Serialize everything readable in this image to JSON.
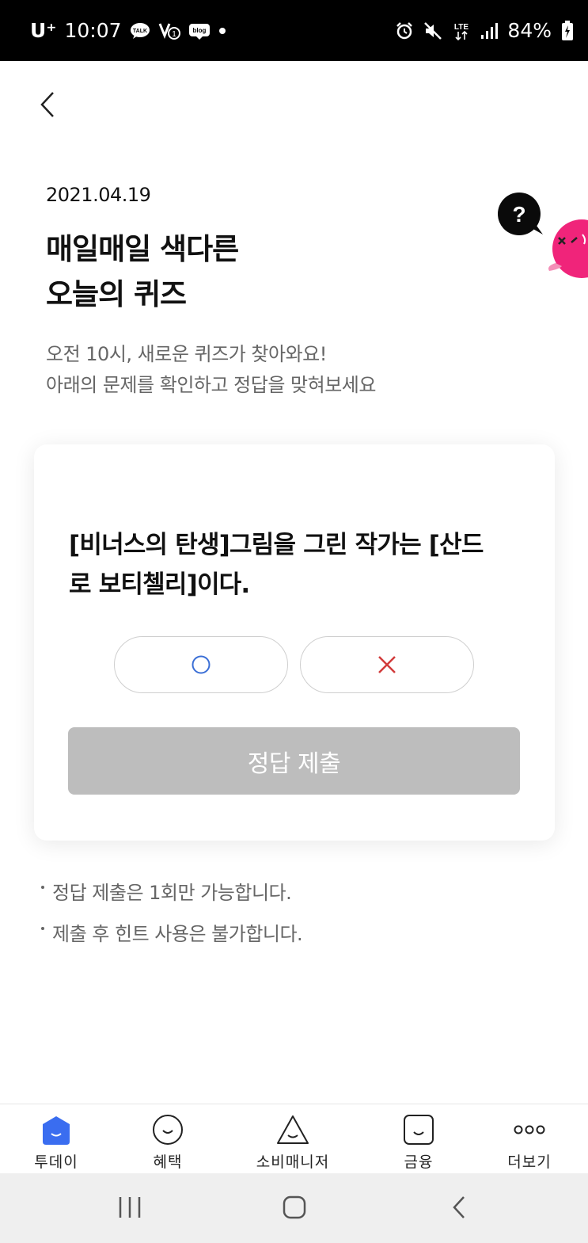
{
  "status_bar": {
    "carrier": "U⁺",
    "time": "10:07",
    "battery": "84%",
    "network": "LTE",
    "notification_icons": [
      "talk-icon",
      "vpn-icon",
      "blog-icon",
      "dot-icon"
    ],
    "system_icons": [
      "alarm-icon",
      "mute-icon",
      "lte-icon",
      "signal-icon",
      "battery-icon"
    ]
  },
  "header": {
    "back_icon": "chevron-left-icon"
  },
  "quiz": {
    "date": "2021.04.19",
    "title_line1": "매일매일 색다른",
    "title_line2": "오늘의 퀴즈",
    "subtitle_line1": "오전 10시, 새로운 퀴즈가 찾아와요!",
    "subtitle_line2": "아래의 문제를 확인하고 정답을 맞혀보세요",
    "mascot_badge": "?",
    "question_line1": "[비너스의 탄생]그림을 그린 작가는 [산드",
    "question_line2": "로 보티첼리]이다.",
    "choices": [
      {
        "name": "O",
        "icon": "circle-icon",
        "color": "#3b6fd6"
      },
      {
        "name": "X",
        "icon": "cross-icon",
        "color": "#d23b3b"
      }
    ],
    "submit_label": "정답 제출"
  },
  "notes": [
    "정답 제출은 1회만 가능합니다.",
    "제출 후 힌트 사용은 불가합니다."
  ],
  "bottom_nav": [
    {
      "label": "투데이",
      "icon": "home-icon",
      "active": true
    },
    {
      "label": "혜택",
      "icon": "smile-circle-icon",
      "active": false
    },
    {
      "label": "소비매니저",
      "icon": "triangle-smile-icon",
      "active": false
    },
    {
      "label": "금융",
      "icon": "square-smile-icon",
      "active": false
    },
    {
      "label": "더보기",
      "icon": "more-dots-icon",
      "active": false
    }
  ],
  "system_nav": [
    "recents-icon",
    "home-button-icon",
    "back-icon"
  ],
  "colors": {
    "accent": "#3a6df0",
    "submit_disabled": "#bdbdbd",
    "mascot_pink": "#f0247a",
    "o_mark": "#3b6fd6",
    "x_mark": "#d23b3b"
  }
}
